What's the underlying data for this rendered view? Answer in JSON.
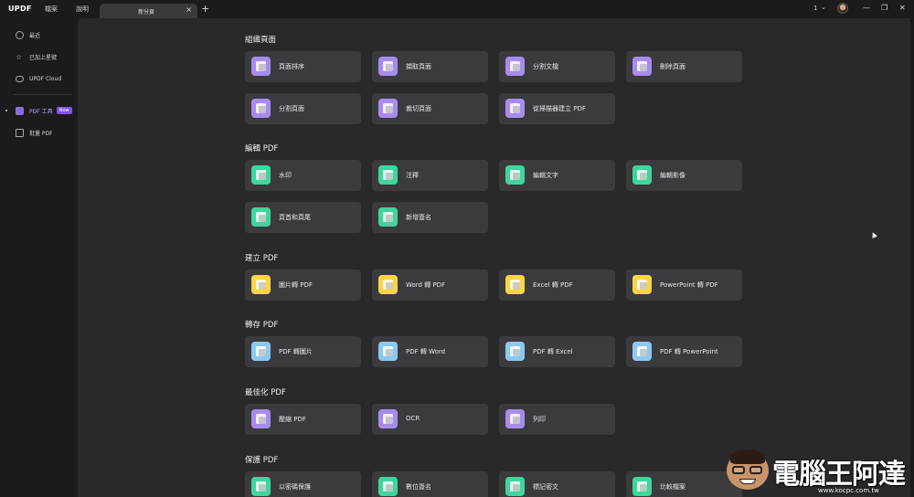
{
  "app": {
    "logo_main": "UPDF",
    "menu": [
      "檔案",
      "說明"
    ],
    "tab_title": "新分頁",
    "tab_close": "×",
    "tab_add": "+",
    "page_count": "1",
    "window_controls": [
      "—",
      "❐",
      "✕"
    ]
  },
  "sidebar": {
    "items": [
      {
        "label": "最近",
        "icon": "clock-icon"
      },
      {
        "label": "已加上星號",
        "icon": "star-icon"
      },
      {
        "label": "UPDF Cloud",
        "icon": "cloud-icon"
      },
      {
        "label": "PDF 工具",
        "icon": "toolbox-icon",
        "badge": "New"
      },
      {
        "label": "批量 PDF",
        "icon": "batch-icon"
      }
    ]
  },
  "sections": [
    {
      "title": "組織頁面",
      "color": "#a88bf0",
      "cards": [
        "頁面排序",
        "擷取頁面",
        "分割文檔",
        "刪除頁面",
        "分割頁面",
        "裁切頁面",
        "從掃描器建立 PDF"
      ]
    },
    {
      "title": "編輯 PDF",
      "color": "#3fd69c",
      "cards": [
        "水印",
        "注釋",
        "編輯文字",
        "編輯影像",
        "頁首和頁尾",
        "新增簽名"
      ]
    },
    {
      "title": "建立 PDF",
      "color": "#ffd34a",
      "cards": [
        "圖片轉 PDF",
        "Word 轉 PDF",
        "Excel 轉 PDF",
        "PowerPoint 轉 PDF"
      ]
    },
    {
      "title": "轉存 PDF",
      "color": "#8bc9ee",
      "cards": [
        "PDF 轉圖片",
        "PDF 轉 Word",
        "PDF 轉 Excel",
        "PDF 轉 PowerPoint"
      ]
    },
    {
      "title": "最佳化 PDF",
      "color": "#a88bf0",
      "cards": [
        "壓縮 PDF",
        "OCR",
        "列印"
      ]
    },
    {
      "title": "保護 PDF",
      "color": "#3fd69c",
      "cards": [
        "以密碼保護",
        "數位簽名",
        "標記密文",
        "比較檔案"
      ]
    }
  ],
  "watermark": {
    "text": "電腦王阿達",
    "url": "www.kocpc.com.tw"
  }
}
